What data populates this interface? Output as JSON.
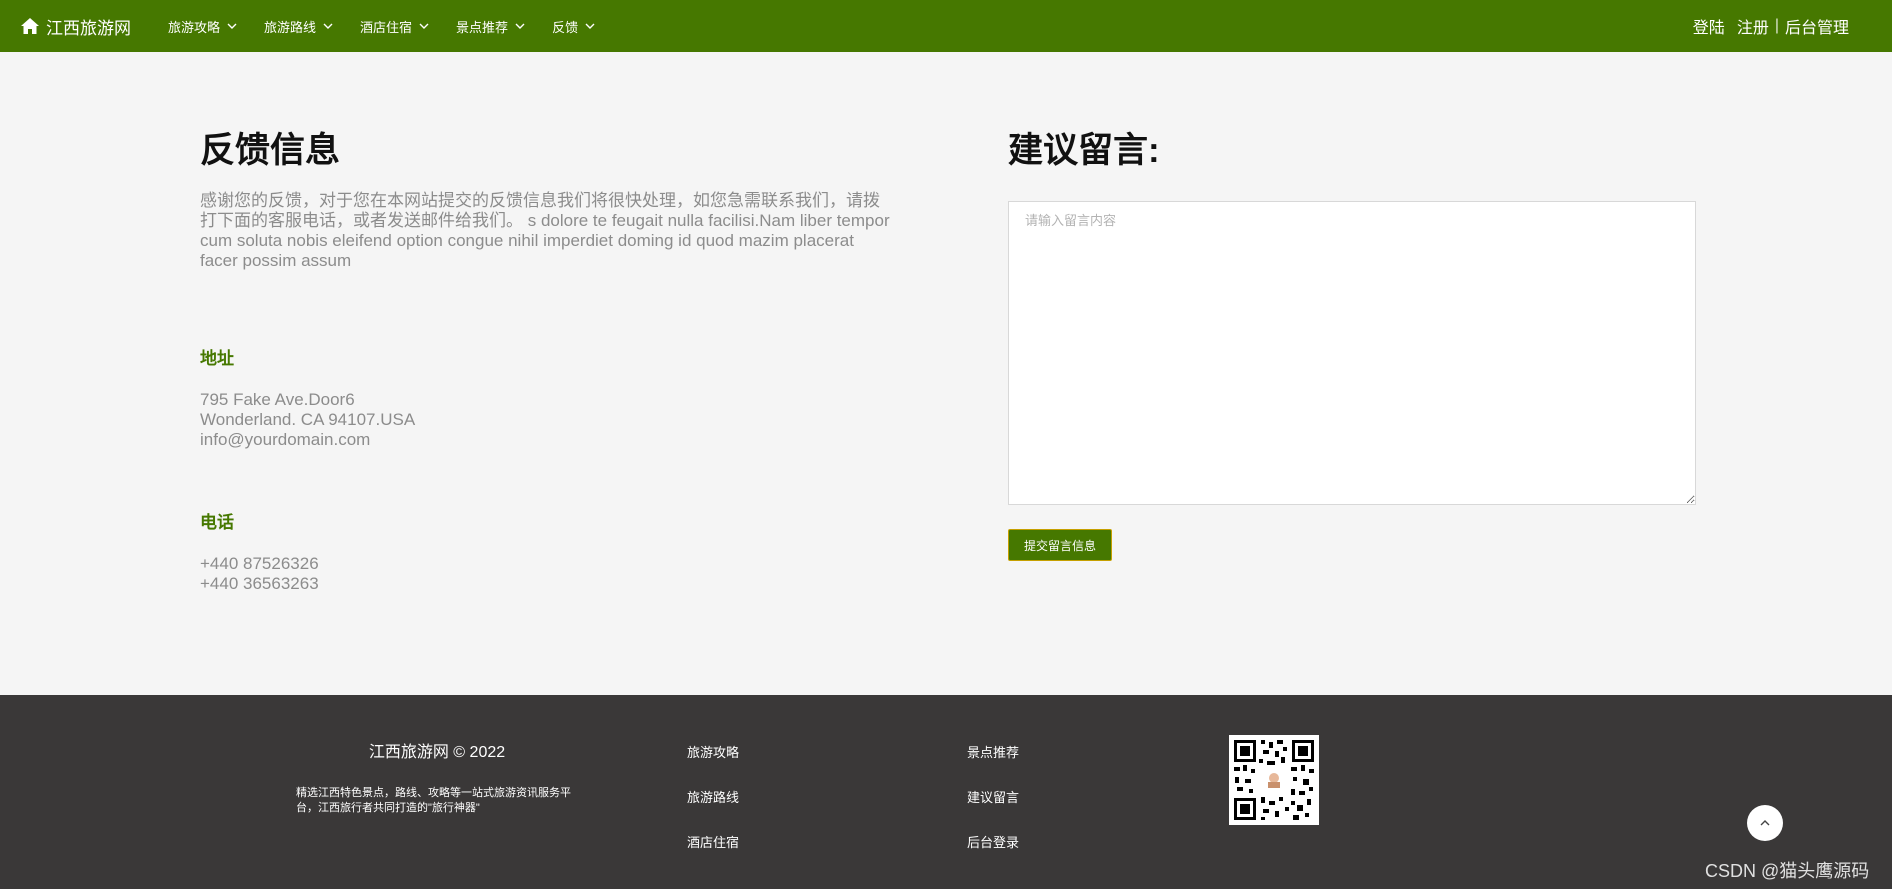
{
  "nav": {
    "brand": "江西旅游网",
    "menu": [
      {
        "label": "旅游攻略"
      },
      {
        "label": "旅游路线"
      },
      {
        "label": "酒店住宿"
      },
      {
        "label": "景点推荐"
      },
      {
        "label": "反馈"
      }
    ],
    "login": "登陆",
    "register": "注册",
    "separator": "|",
    "admin": "后台管理"
  },
  "feedback": {
    "title": "反馈信息",
    "intro": "感谢您的反馈，对于您在本网站提交的反馈信息我们将很快处理，如您急需联系我们，请拨打下面的客服电话，或者发送邮件给我们。 s dolore te feugait nulla facilisi.Nam liber tempor cum soluta nobis eleifend option congue nihil imperdiet doming id quod mazim placerat facer possim assum",
    "address_heading": "地址",
    "address_lines": [
      "795 Fake Ave.Door6",
      "Wonderland. CA 94107.USA",
      "info@yourdomain.com"
    ],
    "phone_heading": "电话",
    "phone_lines": [
      "+440 87526326",
      "+440 36563263"
    ]
  },
  "form": {
    "title": "建议留言:",
    "placeholder": "请输入留言内容",
    "value": "",
    "submit": "提交留言信息"
  },
  "footer": {
    "brand": "江西旅游网 © 2022",
    "description": "精选江西特色景点，路线、攻略等一站式旅游资讯服务平台，江西旅行者共同打造的\"旅行神器\"",
    "links_col1": [
      "旅游攻略",
      "旅游路线",
      "酒店住宿"
    ],
    "links_col2": [
      "景点推荐",
      "建议留言",
      "后台登录"
    ]
  },
  "watermark": "CSDN @猫头鹰源码",
  "colors": {
    "primary": "#467800",
    "footer_bg": "#3a3838",
    "page_bg": "#f5f5f5"
  },
  "icons": [
    "home-icon",
    "chevron-down-icon",
    "qr-code-icon",
    "chevron-up-icon"
  ]
}
